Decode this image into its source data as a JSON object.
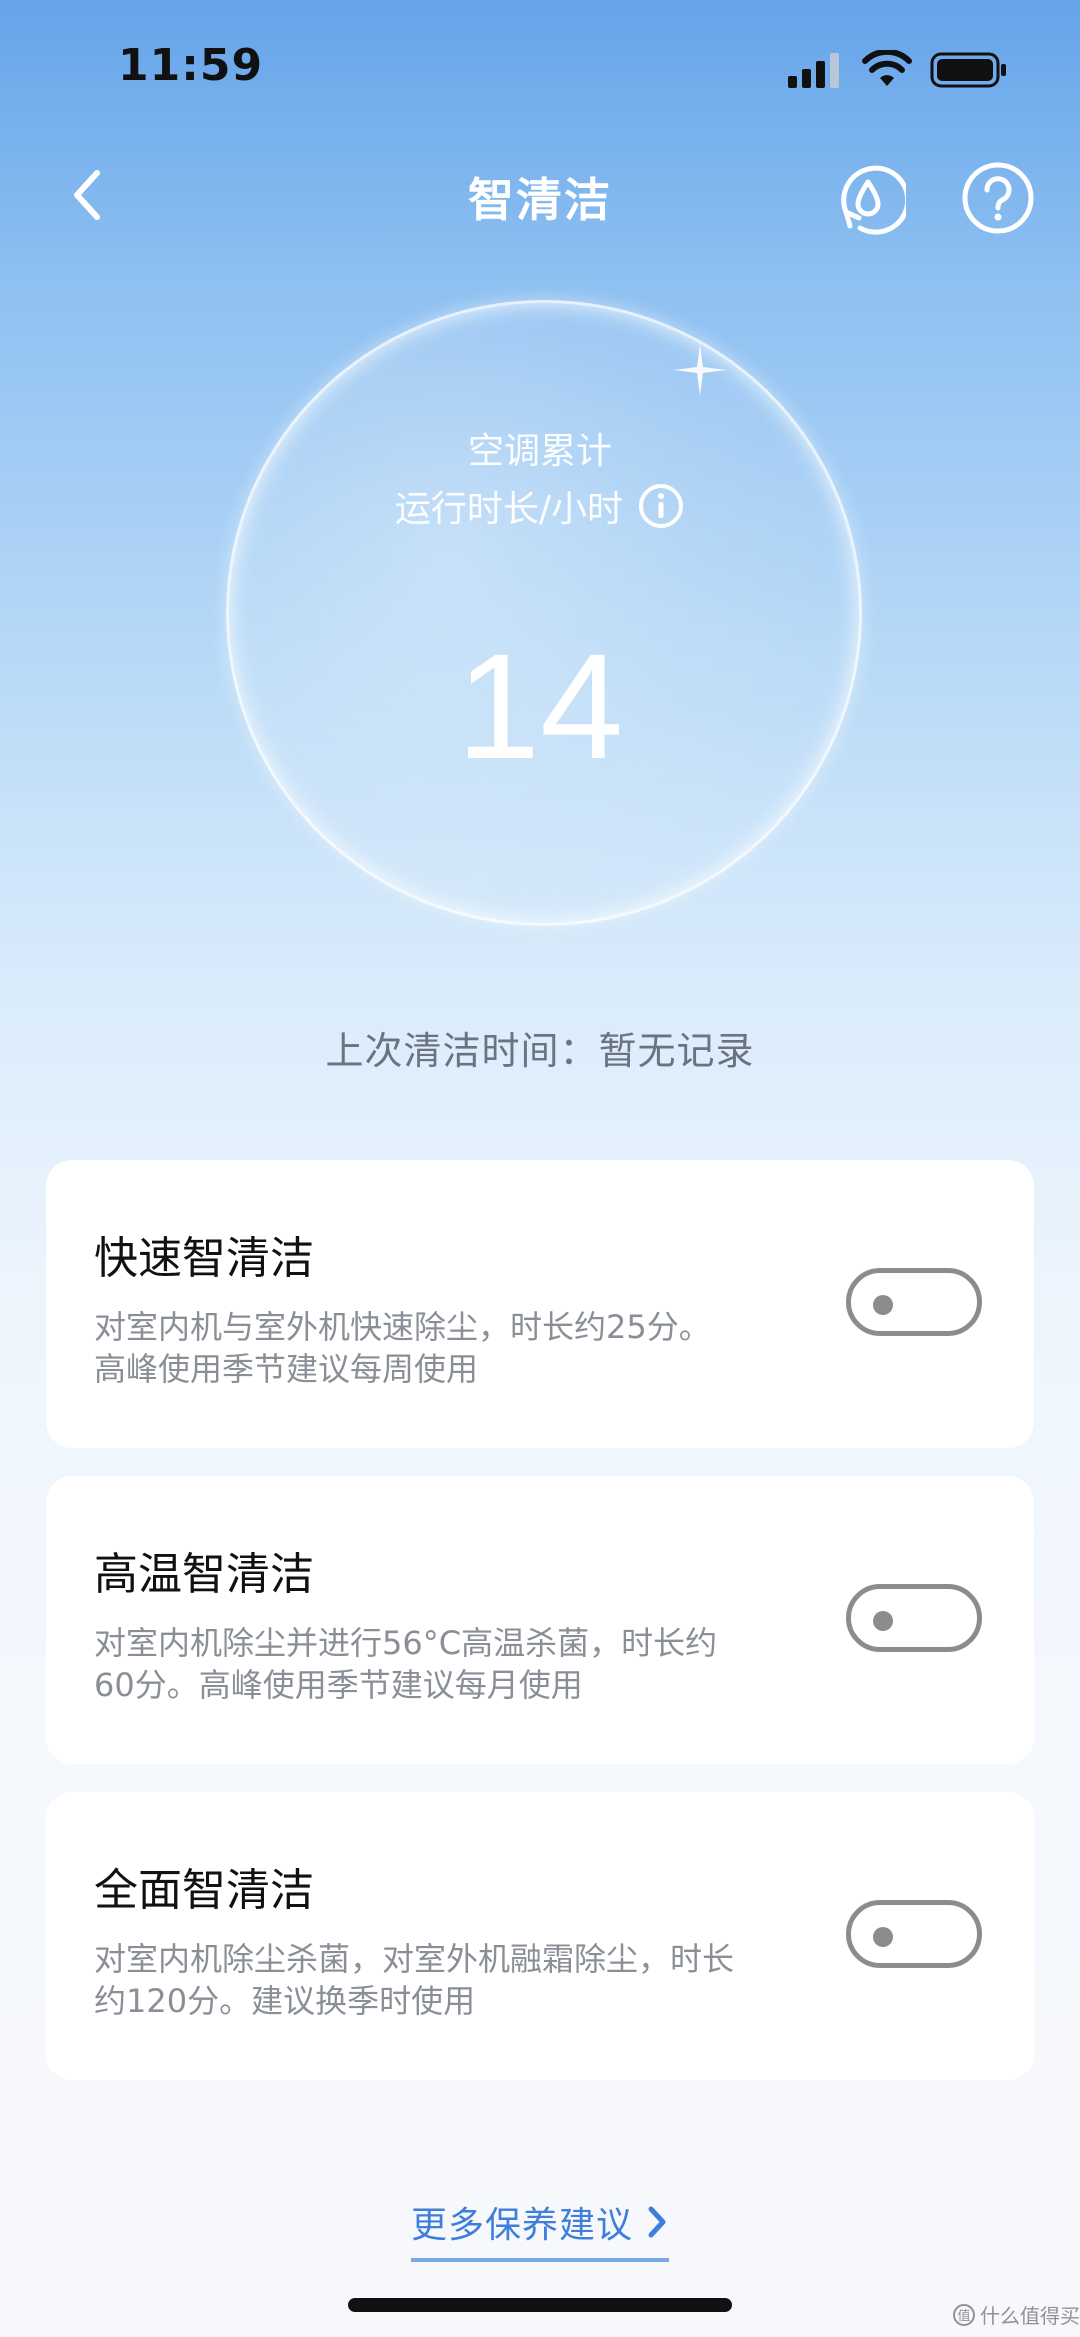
{
  "status_bar": {
    "time": "11:59"
  },
  "nav": {
    "title": "智清洁"
  },
  "runtime": {
    "label_line1": "空调累计",
    "label_line2": "运行时长/小时",
    "value": "14"
  },
  "last_clean": "上次清洁时间：暂无记录",
  "modes": [
    {
      "title": "快速智清洁",
      "desc_line1": "对室内机与室外机快速除尘，时长约25分。",
      "desc_line2": "高峰使用季节建议每周使用",
      "enabled": false
    },
    {
      "title": "高温智清洁",
      "desc_line1": "对室内机除尘并进行56°C高温杀菌，时长约",
      "desc_line2": "60分。高峰使用季节建议每月使用",
      "enabled": false
    },
    {
      "title": "全面智清洁",
      "desc_line1": "对室内机除尘杀菌，对室外机融霜除尘，时长",
      "desc_line2": "约120分。建议换季时使用",
      "enabled": false
    }
  ],
  "more_link": "更多保养建议",
  "watermark": "什么值得买",
  "colors": {
    "accent": "#3f7fdb",
    "toggle_off": "#8c8c8c",
    "card_bg": "#ffffff"
  }
}
